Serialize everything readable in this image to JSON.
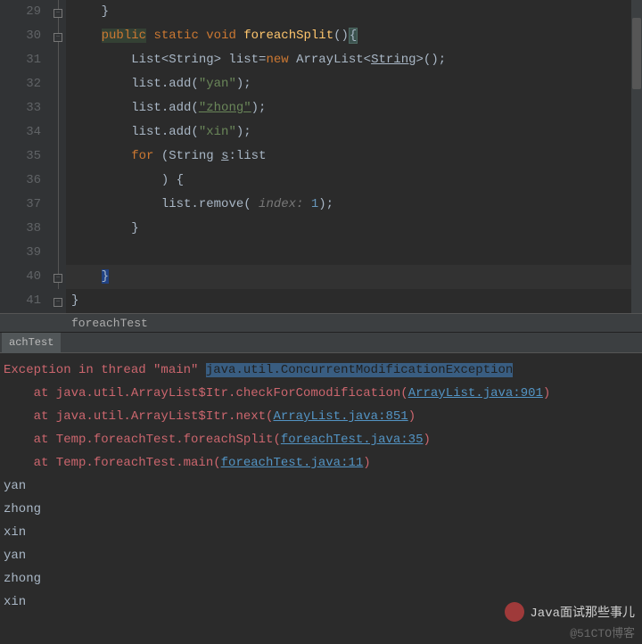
{
  "editor": {
    "lines": [
      {
        "num": "29"
      },
      {
        "num": "30"
      },
      {
        "num": "31"
      },
      {
        "num": "32"
      },
      {
        "num": "33"
      },
      {
        "num": "34"
      },
      {
        "num": "35"
      },
      {
        "num": "36"
      },
      {
        "num": "37"
      },
      {
        "num": "38"
      },
      {
        "num": "39"
      },
      {
        "num": "40"
      },
      {
        "num": "41"
      }
    ],
    "tokens": {
      "l29_brace": "}",
      "l30_public": "public",
      "l30_static": "static",
      "l30_void": "void",
      "l30_method": "foreachSplit",
      "l30_parens": "()",
      "l30_brace": "{",
      "l31_a": "List<String> list=",
      "l31_new": "new",
      "l31_b": " ArrayList<",
      "l31_c": "String",
      "l31_d": ">();",
      "l32_a": "list.add(",
      "l32_str": "\"yan\"",
      "l32_b": ");",
      "l33_a": "list.add(",
      "l33_str": "\"zhong\"",
      "l33_b": ");",
      "l34_a": "list.add(",
      "l34_str": "\"xin\"",
      "l34_b": ");",
      "l35_for": "for",
      "l35_a": " (String ",
      "l35_s": "s",
      "l35_b": ":list",
      "l36_a": ") {",
      "l37_a": "list.remove( ",
      "l37_hint": "index: ",
      "l37_num": "1",
      "l37_b": ");",
      "l38_brace": "}",
      "l40_brace": "}",
      "l41_brace": "}"
    }
  },
  "breadcrumb": "foreachTest",
  "tab": "achTest",
  "console": {
    "ex_prefix": "Exception in thread \"main\" ",
    "ex_sel": "java.util.ConcurrentModificationException",
    "trace1_a": "    at java.util.ArrayList$Itr.checkForComodification(",
    "trace1_link": "ArrayList.java:901",
    "trace1_b": ")",
    "trace2_a": "    at java.util.ArrayList$Itr.next(",
    "trace2_link": "ArrayList.java:851",
    "trace2_b": ")",
    "trace3_a": "    at Temp.foreachTest.foreachSplit(",
    "trace3_link": "foreachTest.java:35",
    "trace3_b": ")",
    "trace4_a": "    at Temp.foreachTest.main(",
    "trace4_link": "foreachTest.java:11",
    "trace4_b": ")",
    "out1": "yan",
    "out2": "zhong",
    "out3": "xin",
    "out4": "yan",
    "out5": "zhong",
    "out6": "xin"
  },
  "watermark": {
    "top": "Java面试那些事儿",
    "bottom": "@51CTO博客"
  }
}
